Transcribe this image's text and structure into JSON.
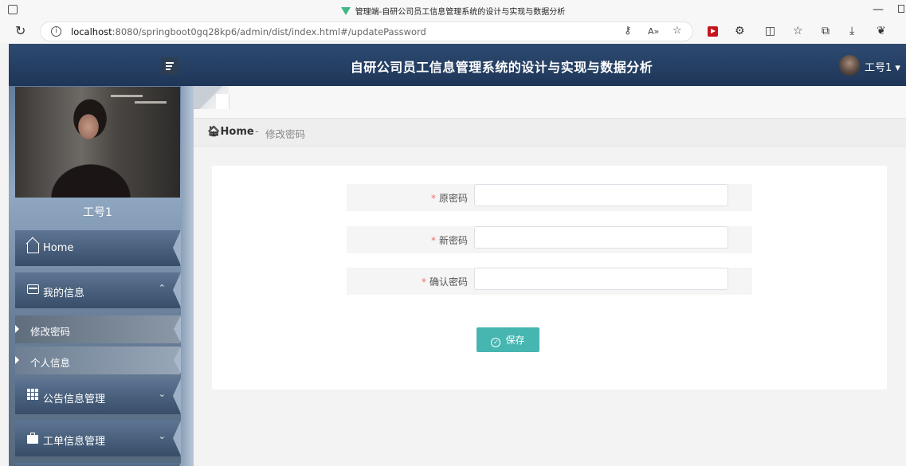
{
  "browser": {
    "tab_title": "管理端-自研公司员工信息管理系统的设计与实现与数据分析",
    "url_host": "localhost",
    "url_rest": ":8080/springboot0gq28kp6/admin/dist/index.html#/updatePassword"
  },
  "header": {
    "title": "自研公司员工信息管理系统的设计与实现与数据分析",
    "user_name": "工号1 ▾"
  },
  "sidebar": {
    "profile_name": "工号1",
    "items": [
      {
        "label": "Home",
        "icon": "home-icon"
      },
      {
        "label": "我的信息",
        "icon": "card-icon",
        "chevron": "⌃"
      },
      {
        "label": "修改密码"
      },
      {
        "label": "个人信息"
      },
      {
        "label": "公告信息管理",
        "icon": "grid-icon",
        "chevron": "⌄"
      },
      {
        "label": "工单信息管理",
        "icon": "briefcase-icon",
        "chevron": "⌄"
      }
    ]
  },
  "breadcrumb": {
    "home": "Home",
    "separator": "-",
    "current": "修改密码"
  },
  "form": {
    "required_mark": "*",
    "fields": [
      {
        "label": "原密码",
        "value": ""
      },
      {
        "label": "新密码",
        "value": ""
      },
      {
        "label": "确认密码",
        "value": ""
      }
    ],
    "save_label": "保存"
  },
  "colors": {
    "header_bg": "#253f63",
    "save_button": "#47b5b0",
    "required": "#f56c6c"
  }
}
